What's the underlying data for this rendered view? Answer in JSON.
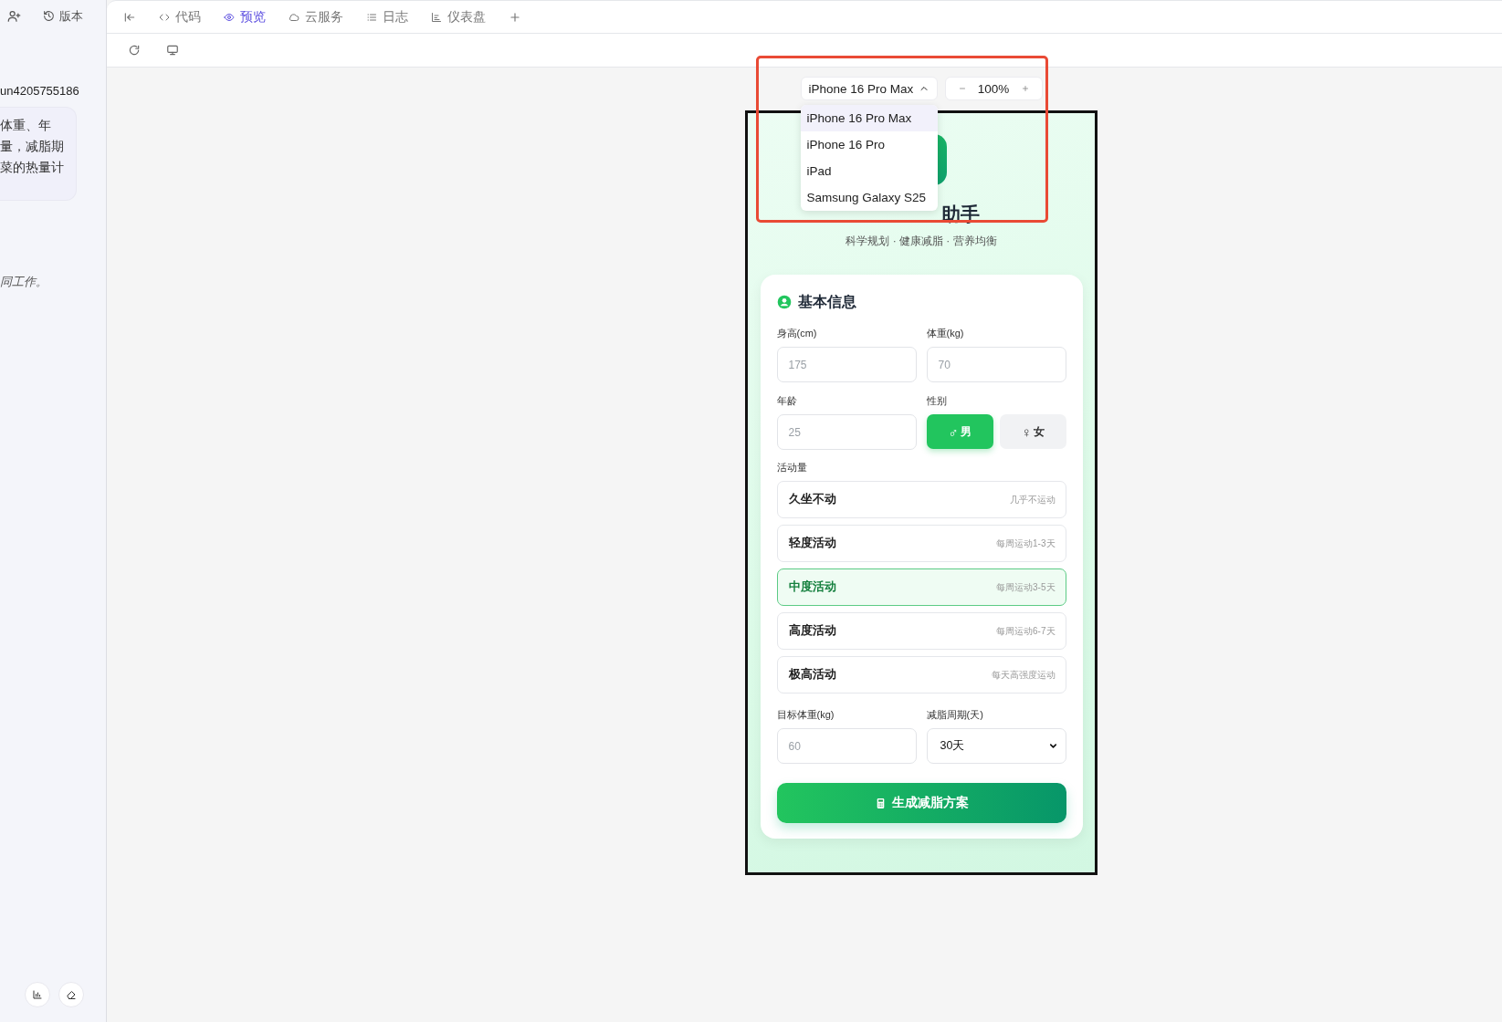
{
  "sidebar": {
    "version_button": "版本",
    "user_id": "un4205755186",
    "message_lines": [
      "体重、年",
      "量，减脂期",
      "菜的热量计"
    ],
    "note": "同工作。"
  },
  "tabs": [
    {
      "label": "代码",
      "kind": "code",
      "selected": false
    },
    {
      "label": "预览",
      "kind": "preview",
      "selected": true
    },
    {
      "label": "云服务",
      "kind": "cloud",
      "selected": false
    },
    {
      "label": "日志",
      "kind": "log",
      "selected": false
    },
    {
      "label": "仪表盘",
      "kind": "dashboard",
      "selected": false
    }
  ],
  "device_selector": {
    "value": "iPhone 16 Pro Max",
    "expanded": true,
    "options": [
      {
        "label": "iPhone 16 Pro Max",
        "selected": true
      },
      {
        "label": "iPhone 16 Pro",
        "selected": false
      },
      {
        "label": "iPad",
        "selected": false
      },
      {
        "label": "Samsung Galaxy S25",
        "selected": false
      }
    ]
  },
  "zoom": {
    "value": "100%"
  },
  "app": {
    "title": "助手",
    "subtitle": "科学规划 · 健康减脂 · 营养均衡",
    "section_title": "基本信息",
    "fields": [
      {
        "label": "身高(cm)",
        "placeholder": "175"
      },
      {
        "label": "体重(kg)",
        "placeholder": "70"
      },
      {
        "label": "年龄",
        "placeholder": "25"
      }
    ],
    "gender": {
      "label": "性别",
      "options": [
        {
          "symbol": "♂",
          "label": "男",
          "selected": true
        },
        {
          "symbol": "♀",
          "label": "女",
          "selected": false
        }
      ]
    },
    "activity": {
      "label": "活动量",
      "options": [
        {
          "name": "久坐不动",
          "description": "几乎不运动",
          "selected": false
        },
        {
          "name": "轻度活动",
          "description": "每周运动1-3天",
          "selected": false
        },
        {
          "name": "中度活动",
          "description": "每周运动3-5天",
          "selected": true
        },
        {
          "name": "高度活动",
          "description": "每周运动6-7天",
          "selected": false
        },
        {
          "name": "极高活动",
          "description": "每天高强度运动",
          "selected": false
        }
      ]
    },
    "target": {
      "label": "目标体重(kg)",
      "placeholder": "60"
    },
    "period": {
      "label": "减脂周期(天)",
      "value": "30天"
    },
    "submit": "生成减脂方案"
  }
}
